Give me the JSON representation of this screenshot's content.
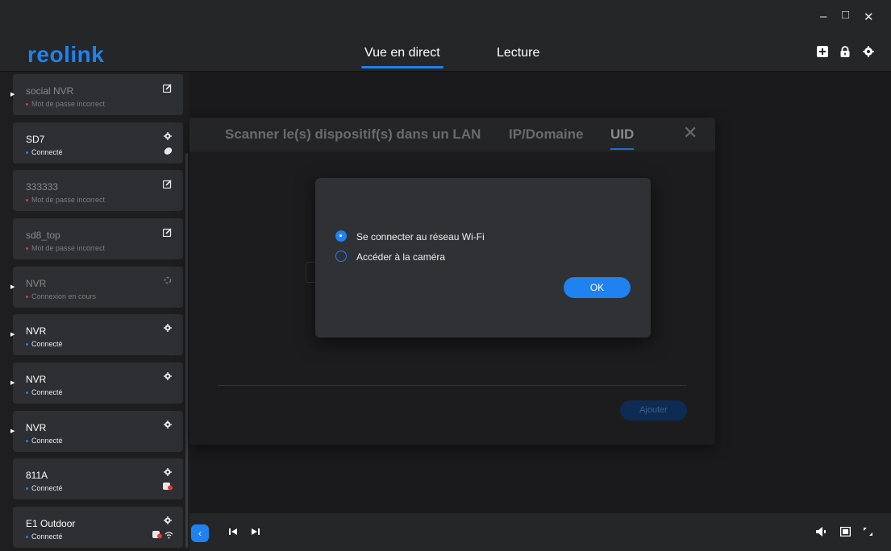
{
  "window": {
    "minimize": "–",
    "maximize": "□",
    "close": "✕"
  },
  "header": {
    "logo": "reolink",
    "tabs": [
      {
        "label": "Vue en direct",
        "active": true
      },
      {
        "label": "Lecture",
        "active": false
      }
    ],
    "icons": [
      "add-device-icon",
      "lock-icon",
      "settings-icon"
    ]
  },
  "devices": [
    {
      "name": "social NVR",
      "status": "Mot de passe incorrect",
      "state": "error",
      "icon": "edit-icon"
    },
    {
      "name": "SD7",
      "status": "Connecté",
      "state": "ok",
      "icon": "gear-icon",
      "icon2": "battery-icon"
    },
    {
      "name": "333333",
      "status": "Mot de passe incorrect",
      "state": "error",
      "icon": "edit-icon"
    },
    {
      "name": "sd8_top",
      "status": "Mot de passe incorrect",
      "state": "error",
      "icon": "edit-icon"
    },
    {
      "name": "NVR",
      "status": "Connexion en cours",
      "state": "connecting",
      "icon": "spinner-icon"
    },
    {
      "name": "NVR",
      "status": "Connecté",
      "state": "ok",
      "icon": "gear-icon"
    },
    {
      "name": "NVR",
      "status": "Connecté",
      "state": "ok",
      "icon": "gear-icon"
    },
    {
      "name": "NVR",
      "status": "Connecté",
      "state": "ok",
      "icon": "gear-icon"
    },
    {
      "name": "811A",
      "status": "Connecté",
      "state": "ok",
      "icon": "gear-icon",
      "icon2": "camera-icon"
    },
    {
      "name": "E1 Outdoor",
      "status": "Connecté",
      "state": "ok",
      "icon": "gear-icon",
      "icon2": "camera-wifi-icon"
    }
  ],
  "panel": {
    "tabs": [
      {
        "label": "Scanner le(s) dispositif(s) dans un LAN",
        "active": false
      },
      {
        "label": "IP/Domaine",
        "active": false
      },
      {
        "label": "UID",
        "active": true
      }
    ],
    "add_label": "Ajouter"
  },
  "modal": {
    "options": [
      {
        "label": "Se connecter au réseau Wi-Fi",
        "selected": true
      },
      {
        "label": "Accéder à la caméra",
        "selected": false
      }
    ],
    "ok_label": "OK"
  },
  "colors": {
    "accent": "#1f82f0",
    "error": "#e53935",
    "background": "#1a1a1c",
    "card": "#2e2f33"
  }
}
